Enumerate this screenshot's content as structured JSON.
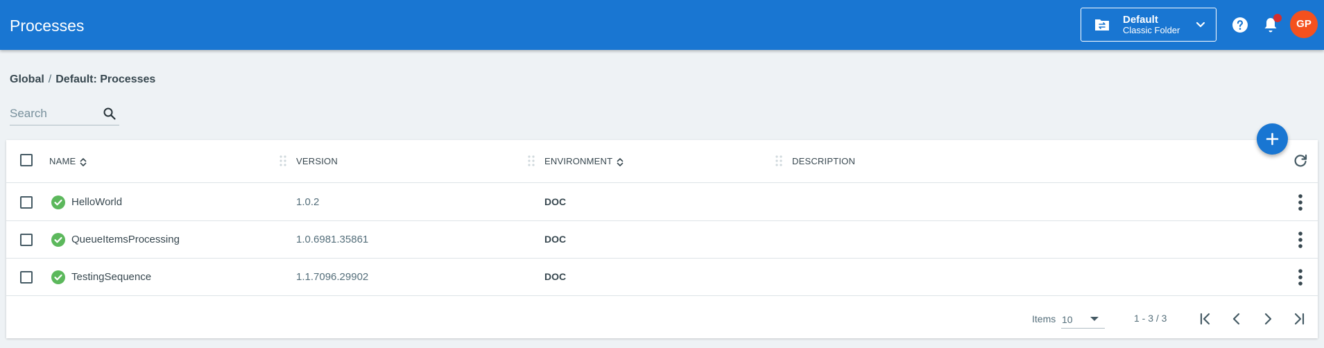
{
  "header": {
    "title": "Processes",
    "folder": {
      "name": "Default",
      "subtitle": "Classic Folder"
    },
    "avatar_initials": "GP",
    "accent_color": "#1976d2"
  },
  "breadcrumb": {
    "root": "Global",
    "separator": "/",
    "current": "Default: Processes"
  },
  "search": {
    "placeholder": "Search",
    "value": ""
  },
  "table": {
    "columns": [
      {
        "label": "NAME",
        "sortable": true
      },
      {
        "label": "VERSION",
        "sortable": false
      },
      {
        "label": "ENVIRONMENT",
        "sortable": true
      },
      {
        "label": "DESCRIPTION",
        "sortable": false
      }
    ],
    "rows": [
      {
        "name": "HelloWorld",
        "version": "1.0.2",
        "environment": "DOC",
        "description": "",
        "status": "check-circle-icon"
      },
      {
        "name": "QueueItemsProcessing",
        "version": "1.0.6981.35861",
        "environment": "DOC",
        "description": "",
        "status": "check-circle-icon"
      },
      {
        "name": "TestingSequence",
        "version": "1.1.7096.29902",
        "environment": "DOC",
        "description": "",
        "status": "check-circle-icon"
      }
    ]
  },
  "pagination": {
    "items_label": "Items",
    "page_size": "10",
    "range": "1 - 3 / 3"
  },
  "icons": {
    "folder": "folder-switch-icon",
    "help": "help-icon",
    "notifications": "bell-icon",
    "add": "plus-icon",
    "refresh": "refresh-icon",
    "row_menu": "more-vert-icon"
  },
  "colors": {
    "status_ok": "#5cb85c",
    "notification_dot": "#d32f2f",
    "avatar_bg": "#f4511e"
  }
}
